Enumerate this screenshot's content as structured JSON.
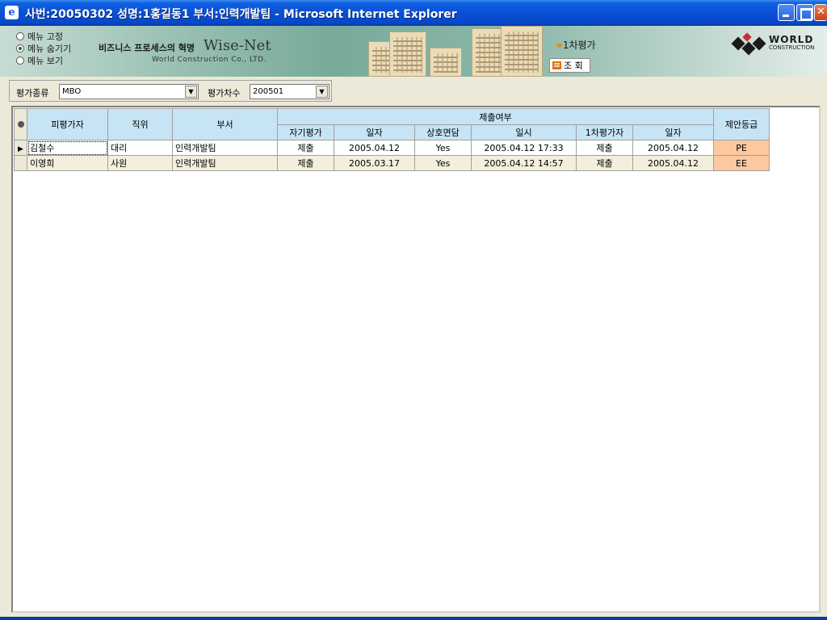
{
  "window": {
    "title": "사번:20050302 성명:1홍길동1 부서:인력개발팀 - Microsoft Internet Explorer",
    "icon_glyph": "e"
  },
  "banner": {
    "menu_options": [
      {
        "label": "메뉴 고정",
        "selected": false
      },
      {
        "label": "메뉴 숨기기",
        "selected": true
      },
      {
        "label": "메뉴 보기",
        "selected": false
      }
    ],
    "slogan": "비즈니스 프로세스의 혁명",
    "brand": "Wise-Net",
    "brand_sub": "World Construction Co., LTD.",
    "nav_step": "1차평가",
    "query_button": "조 회",
    "logo_word": "WORLD",
    "logo_sub": "CONSTRUCTION"
  },
  "filters": {
    "type_label": "평가종류",
    "type_value": "MBO",
    "round_label": "평가차수",
    "round_value": "200501"
  },
  "grid": {
    "headers": {
      "evaluatee": "피평가자",
      "position": "직위",
      "department": "부서",
      "submission_group": "제출여부",
      "self_eval": "자기평가",
      "date1": "일자",
      "mutual_interview": "상호면담",
      "datetime": "일시",
      "first_evaluator": "1차평가자",
      "date2": "일자",
      "proposed_grade": "제안등급"
    },
    "rows": [
      {
        "name": "김철수",
        "position": "대리",
        "dept": "인력개발팀",
        "self": "제출",
        "date1": "2005.04.12",
        "interview": "Yes",
        "datetime": "2005.04.12 17:33",
        "first": "제출",
        "date2": "2005.04.12",
        "grade": "PE"
      },
      {
        "name": "이영희",
        "position": "사원",
        "dept": "인력개발팀",
        "self": "제출",
        "date1": "2005.03.17",
        "interview": "Yes",
        "datetime": "2005.04.12 14:57",
        "first": "제출",
        "date2": "2005.04.12",
        "grade": "EE"
      }
    ]
  },
  "colors": {
    "header_bg": "#c6e4f4",
    "grade_bg": "#fcc8a0",
    "titlebar": "#0a50d8"
  }
}
